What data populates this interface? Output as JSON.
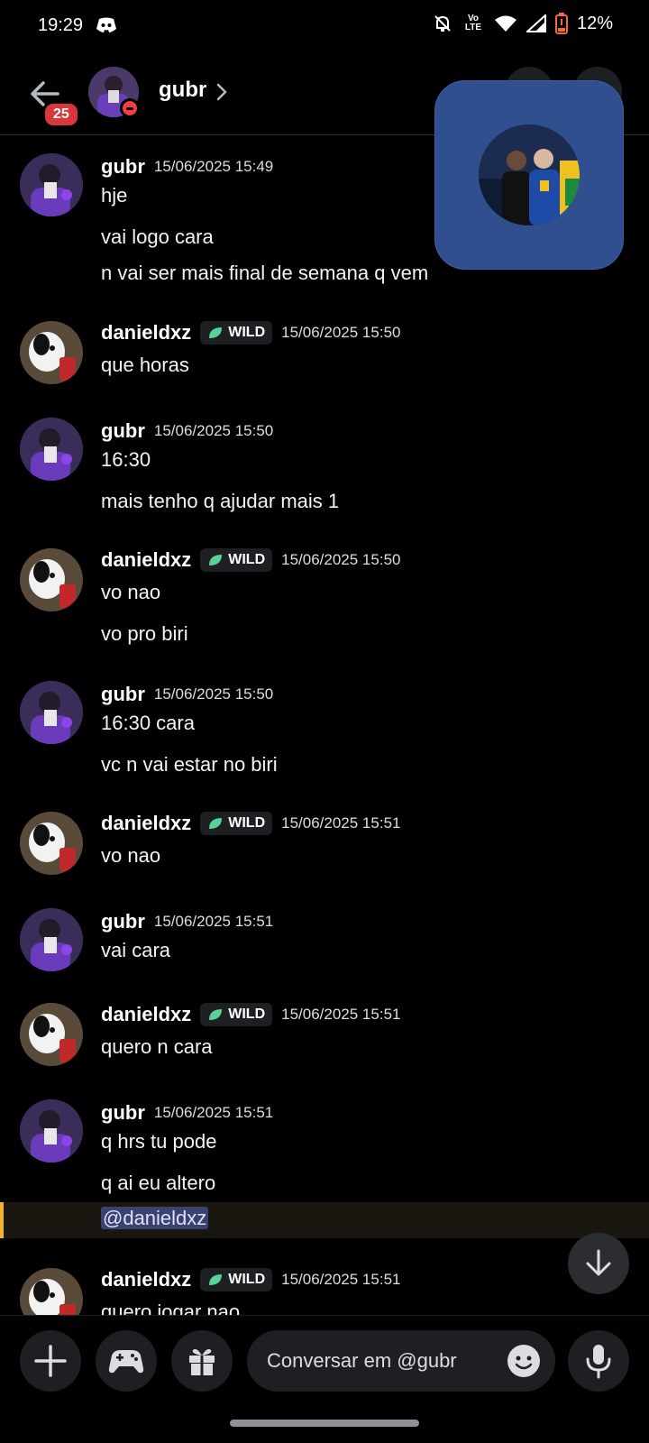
{
  "status_bar": {
    "time": "19:29",
    "battery": "12%",
    "network": "Vo LTE"
  },
  "header": {
    "back_badge": "25",
    "name": "gubr"
  },
  "messages": [
    {
      "author": "gubr",
      "time": "15/06/2025 15:49",
      "lines": [
        "hje",
        "vai logo cara",
        "n vai ser mais final de semana q vem"
      ]
    },
    {
      "author": "danieldxz",
      "badge": "WILD",
      "time": "15/06/2025 15:50",
      "lines": [
        "que horas"
      ]
    },
    {
      "author": "gubr",
      "time": "15/06/2025 15:50",
      "lines": [
        "16:30",
        "mais tenho q ajudar mais 1"
      ]
    },
    {
      "author": "danieldxz",
      "badge": "WILD",
      "time": "15/06/2025 15:50",
      "lines": [
        "vo nao",
        "vo pro biri"
      ]
    },
    {
      "author": "gubr",
      "time": "15/06/2025 15:50",
      "lines": [
        "16:30 cara",
        "vc n vai estar no biri"
      ]
    },
    {
      "author": "danieldxz",
      "badge": "WILD",
      "time": "15/06/2025 15:51",
      "lines": [
        "vo nao"
      ]
    },
    {
      "author": "gubr",
      "time": "15/06/2025 15:51",
      "lines": [
        "vai cara"
      ]
    },
    {
      "author": "danieldxz",
      "badge": "WILD",
      "time": "15/06/2025 15:51",
      "lines": [
        "quero n cara"
      ]
    },
    {
      "author": "gubr",
      "time": "15/06/2025 15:51",
      "lines": [
        "q hrs tu pode",
        "q ai eu altero",
        "@danieldxz"
      ]
    },
    {
      "author": "danieldxz",
      "badge": "WILD",
      "time": "15/06/2025 15:51",
      "lines": [
        "quero jogar nao"
      ]
    }
  ],
  "composer": {
    "placeholder": "Conversar em @gubr"
  },
  "colors": {
    "background": "#000000",
    "mention_bg": "#3c4270",
    "highlight_bar": "#f0b232",
    "badge_red": "#da373c",
    "video_tile": "#2f4f8f"
  }
}
